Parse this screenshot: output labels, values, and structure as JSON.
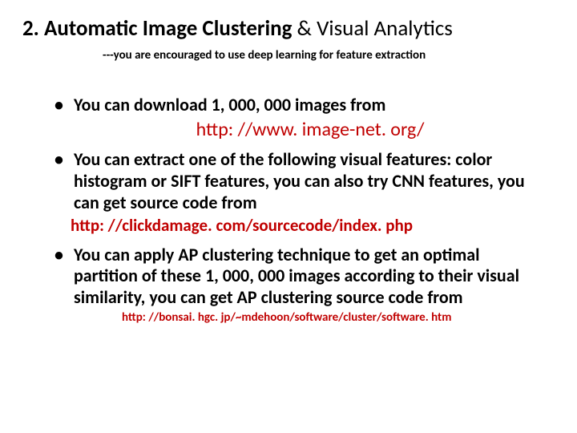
{
  "title": {
    "bold": "2. Automatic Image Clustering",
    "normal": " & Visual Analytics"
  },
  "subtitle": "---you are encouraged to use deep learning for feature extraction",
  "bullets": {
    "b1_text": "You can download 1, 000, 000 images from",
    "b1_link": "http: //www. image-net. org/",
    "b2_text": "You can extract one of the following visual features: color histogram or  SIFT features, you can also try CNN features, you can get source code from",
    "b2_link": "http: //clickdamage. com/sourcecode/index. php",
    "b3_text": "You can apply AP clustering technique to get an optimal partition  of these 1, 000, 000 images according to their visual similarity, you can get AP clustering source code from",
    "b3_link": "http: //bonsai. hgc. jp/~mdehoon/software/cluster/software. htm"
  }
}
